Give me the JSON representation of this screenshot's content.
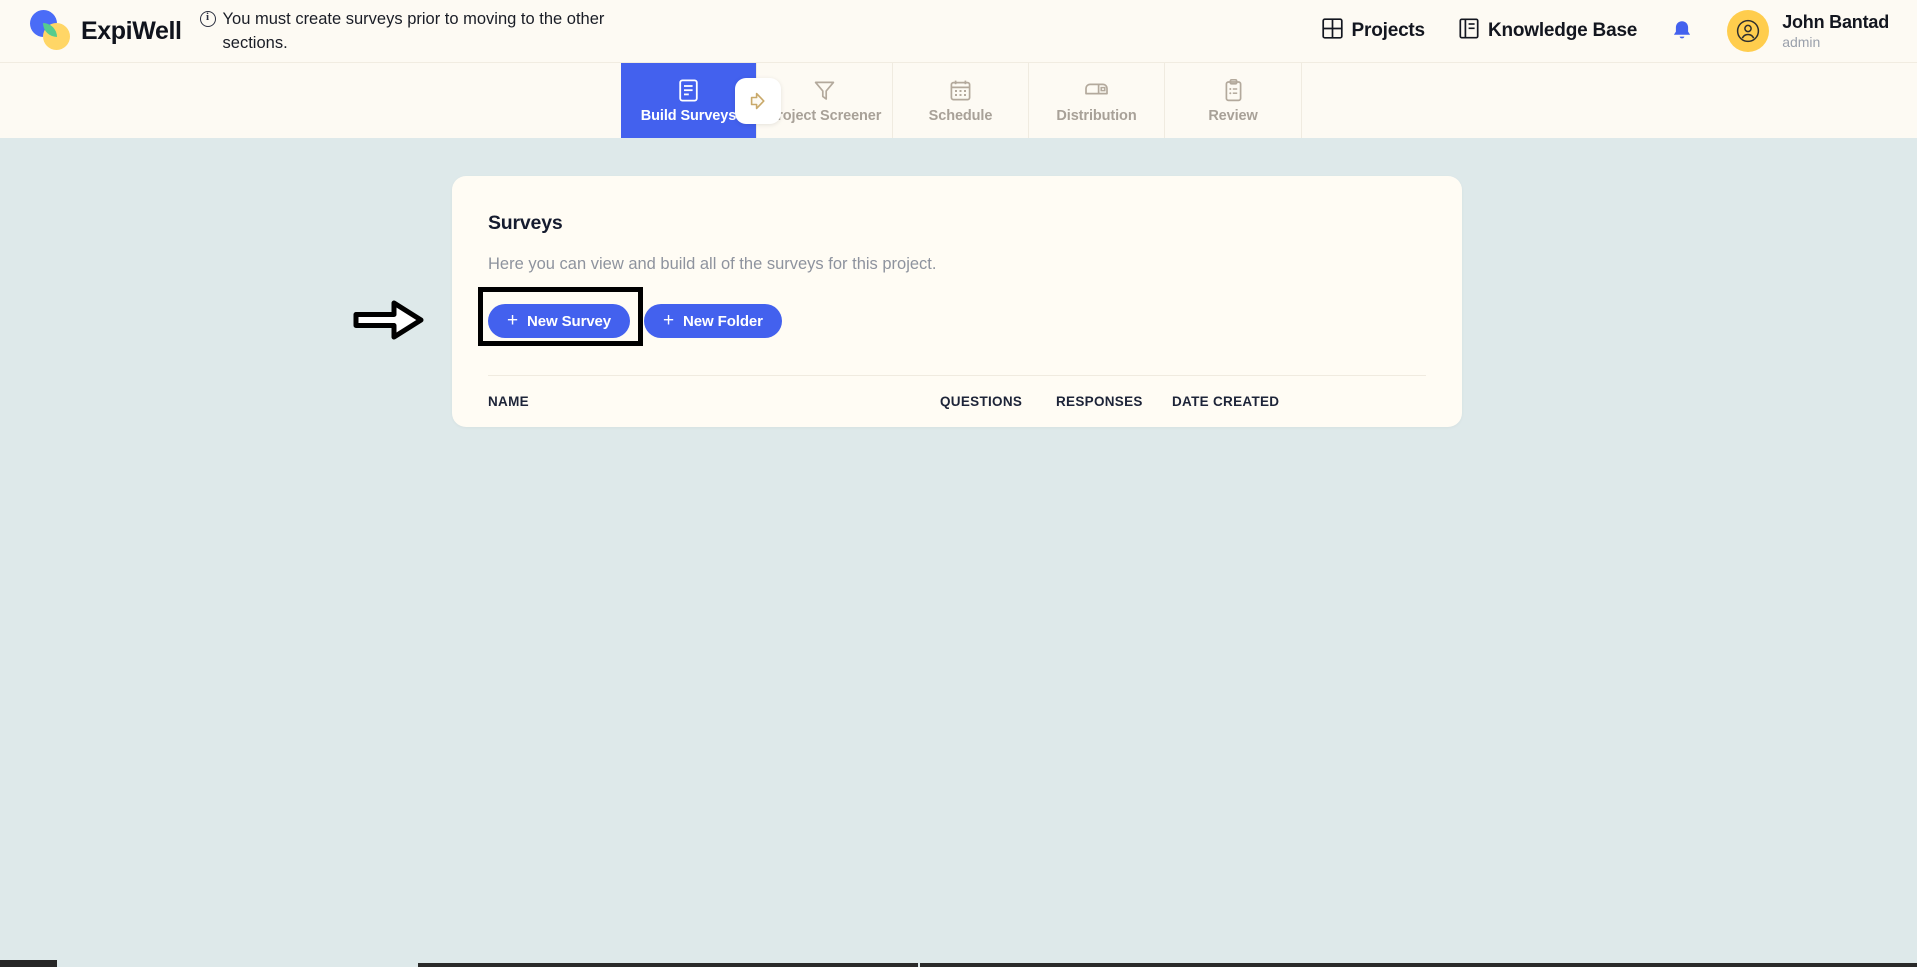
{
  "colors": {
    "accent": "#4361ee",
    "page_bg": "#dee9ea",
    "header_bg": "#fdfaf3",
    "card_bg": "#fffcf4",
    "avatar_bg": "#ffcd4d",
    "logo_blue": "#4a6cf7",
    "logo_green": "#56cc8d",
    "logo_yellow": "#ffd666",
    "muted_text": "#a8a198"
  },
  "header": {
    "brand_name": "ExpiWell",
    "logo_icon": "expiwell-circles-logo",
    "alert": {
      "icon": "info-circle-icon",
      "text": "You must create surveys prior to moving to the other sections."
    },
    "nav": [
      {
        "label": "Projects",
        "icon": "grid-icon"
      },
      {
        "label": "Knowledge Base",
        "icon": "book-icon"
      }
    ],
    "notifications_icon": "bell-icon",
    "user": {
      "avatar_icon": "user-avatar-icon",
      "name": "John Bantad",
      "role": "admin"
    }
  },
  "tabbar": {
    "next_step_icon": "arrow-right-step-icon",
    "tabs": [
      {
        "label": "Build Surveys",
        "icon": "document-list-icon",
        "active": true
      },
      {
        "label": "Project Screener",
        "icon": "funnel-icon",
        "active": false
      },
      {
        "label": "Schedule",
        "icon": "calendar-icon",
        "active": false
      },
      {
        "label": "Distribution",
        "icon": "mailbox-icon",
        "active": false
      },
      {
        "label": "Review",
        "icon": "clipboard-icon",
        "active": false
      }
    ]
  },
  "card": {
    "title": "Surveys",
    "subtitle": "Here you can view and build all of the surveys for this project.",
    "buttons": {
      "new_survey": "New Survey",
      "new_folder": "New Folder",
      "plus_glyph": "+"
    },
    "table": {
      "columns": [
        "NAME",
        "QUESTIONS",
        "RESPONSES",
        "DATE CREATED"
      ],
      "rows": []
    }
  },
  "annotation": {
    "arrow_icon": "annotation-arrow-right",
    "highlight_target": "new-survey-button"
  }
}
